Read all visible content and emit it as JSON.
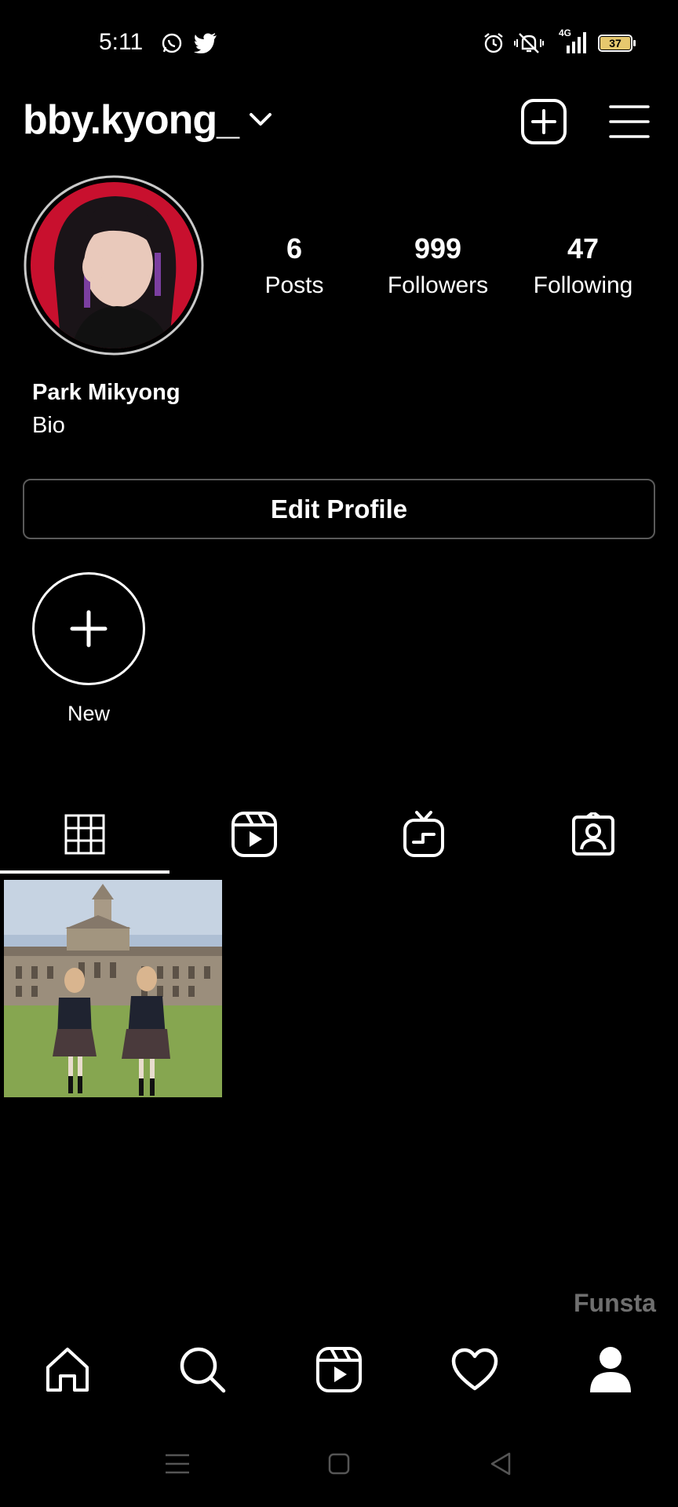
{
  "status_bar": {
    "time": "5:11",
    "network": "4G",
    "battery": "37"
  },
  "header": {
    "username": "bby.kyong_"
  },
  "profile": {
    "full_name": "Park Mikyong",
    "bio": "Bio",
    "stats": [
      {
        "value": "6",
        "label": "Posts"
      },
      {
        "value": "999",
        "label": "Followers"
      },
      {
        "value": "47",
        "label": "Following"
      }
    ],
    "edit_button": "Edit Profile"
  },
  "highlights": {
    "new_label": "New"
  },
  "tabs": [
    {
      "icon": "grid-icon",
      "active": true
    },
    {
      "icon": "reels-icon",
      "active": false
    },
    {
      "icon": "igtv-icon",
      "active": false
    },
    {
      "icon": "tagged-icon",
      "active": false
    }
  ],
  "watermark": "Funsta",
  "bottom_nav": [
    "home-icon",
    "search-icon",
    "reels-icon",
    "heart-icon",
    "profile-icon"
  ],
  "colors": {
    "background": "#000000",
    "text": "#ffffff",
    "avatar_bg": "#c8102e",
    "watermark": "#6f6f6f"
  }
}
